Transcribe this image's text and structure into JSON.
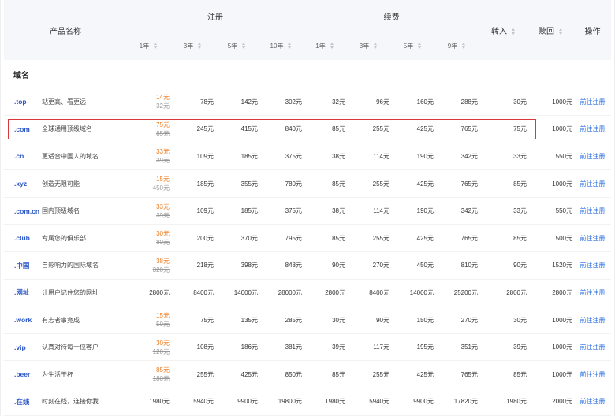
{
  "header": {
    "product_name": "产品名称",
    "register": "注册",
    "renew": "续费",
    "transfer": "转入",
    "redeem": "赎回",
    "action": "操作",
    "years": [
      "1年",
      "3年",
      "5年",
      "10年"
    ],
    "renew_years": [
      "1年",
      "3年",
      "5年",
      "9年"
    ]
  },
  "section_title": "域名",
  "rows": [
    {
      "tld": ".top",
      "desc": "站更高、看更远",
      "sale": "14元",
      "orig": "32元",
      "r3": "78元",
      "r5": "142元",
      "r10": "302元",
      "n1": "32元",
      "n3": "96元",
      "n5": "160元",
      "n9": "288元",
      "transfer": "30元",
      "redeem": "1000元",
      "action": "前往注册"
    },
    {
      "tld": ".com",
      "desc": "全球通用顶级域名",
      "sale": "75元",
      "orig": "85元",
      "r3": "245元",
      "r5": "415元",
      "r10": "840元",
      "n1": "85元",
      "n3": "255元",
      "n5": "425元",
      "n9": "765元",
      "transfer": "75元",
      "redeem": "1000元",
      "action": "前往注册"
    },
    {
      "tld": ".cn",
      "desc": "更适合中国人的域名",
      "sale": "33元",
      "orig": "39元",
      "r3": "109元",
      "r5": "185元",
      "r10": "375元",
      "n1": "38元",
      "n3": "114元",
      "n5": "190元",
      "n9": "342元",
      "transfer": "33元",
      "redeem": "550元",
      "action": "前往注册"
    },
    {
      "tld": ".xyz",
      "desc": "创造无限可能",
      "sale": "15元",
      "orig": "450元",
      "r3": "185元",
      "r5": "355元",
      "r10": "780元",
      "n1": "85元",
      "n3": "255元",
      "n5": "425元",
      "n9": "765元",
      "transfer": "85元",
      "redeem": "1000元",
      "action": "前往注册"
    },
    {
      "tld": ".com.cn",
      "desc": "国内顶级域名",
      "sale": "33元",
      "orig": "39元",
      "r3": "109元",
      "r5": "185元",
      "r10": "375元",
      "n1": "38元",
      "n3": "114元",
      "n5": "190元",
      "n9": "342元",
      "transfer": "33元",
      "redeem": "550元",
      "action": "前往注册"
    },
    {
      "tld": ".club",
      "desc": "专属您的俱乐部",
      "sale": "30元",
      "orig": "80元",
      "r3": "200元",
      "r5": "370元",
      "r10": "795元",
      "n1": "85元",
      "n3": "255元",
      "n5": "425元",
      "n9": "765元",
      "transfer": "85元",
      "redeem": "500元",
      "action": "前往注册"
    },
    {
      "tld": ".中国",
      "desc": "自影响力的国际域名",
      "sale": "38元",
      "orig": "320元",
      "r3": "218元",
      "r5": "398元",
      "r10": "848元",
      "n1": "90元",
      "n3": "270元",
      "n5": "450元",
      "n9": "810元",
      "transfer": "90元",
      "redeem": "1520元",
      "action": "前往注册"
    },
    {
      "tld": ".网址",
      "desc": "让用户记住您的网址",
      "sale": "",
      "orig": "",
      "r1": "2800元",
      "r3": "8400元",
      "r5": "14000元",
      "r10": "28000元",
      "n1": "2800元",
      "n3": "8400元",
      "n5": "14000元",
      "n9": "25200元",
      "transfer": "2800元",
      "redeem": "2800元",
      "action": "前往注册"
    },
    {
      "tld": ".work",
      "desc": "有志者事竟成",
      "sale": "15元",
      "orig": "50元",
      "r3": "75元",
      "r5": "135元",
      "r10": "285元",
      "n1": "30元",
      "n3": "90元",
      "n5": "150元",
      "n9": "270元",
      "transfer": "30元",
      "redeem": "1000元",
      "action": "前往注册"
    },
    {
      "tld": ".vip",
      "desc": "认真对待每一位客户",
      "sale": "30元",
      "orig": "120元",
      "r3": "108元",
      "r5": "186元",
      "r10": "381元",
      "n1": "39元",
      "n3": "117元",
      "n5": "195元",
      "n9": "351元",
      "transfer": "39元",
      "redeem": "1000元",
      "action": "前往注册"
    },
    {
      "tld": ".beer",
      "desc": "为生活干杯",
      "sale": "85元",
      "orig": "180元",
      "r3": "255元",
      "r5": "425元",
      "r10": "850元",
      "n1": "85元",
      "n3": "255元",
      "n5": "425元",
      "n9": "765元",
      "transfer": "85元",
      "redeem": "1000元",
      "action": "前往注册"
    },
    {
      "tld": ".在线",
      "desc": "时刻在线，连接你我",
      "sale": "",
      "orig": "",
      "r1": "1980元",
      "r3": "5940元",
      "r5": "9900元",
      "r10": "19800元",
      "n1": "1980元",
      "n3": "5940元",
      "n5": "9900元",
      "n9": "17820元",
      "transfer": "1980元",
      "redeem": "2000元",
      "action": "前往注册"
    }
  ]
}
